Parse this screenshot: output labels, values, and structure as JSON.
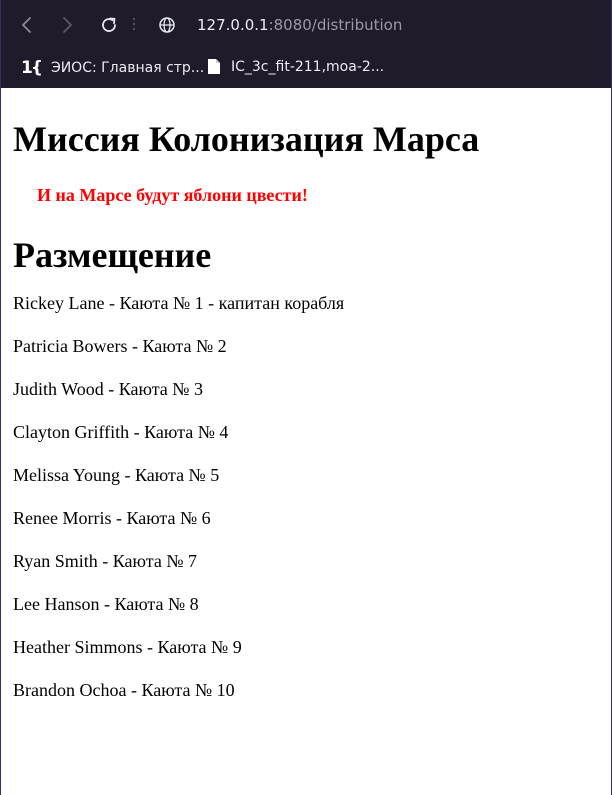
{
  "browser": {
    "url_host": "127.0.0.1",
    "url_rest": ":8080/distribution",
    "bookmarks": [
      {
        "label": "ЭИОС: Главная стр..."
      },
      {
        "label": "IC_3c_fit-211,moa-2..."
      }
    ]
  },
  "page": {
    "title": "Миссия Колонизация Марса",
    "slogan": "И на Марсе будут яблони цвести!",
    "section_title": "Размещение",
    "assignments": [
      "Rickey Lane - Каюта № 1 - капитан корабля",
      "Patricia Bowers - Каюта № 2",
      "Judith Wood - Каюта № 3",
      "Clayton Griffith - Каюта № 4",
      "Melissa Young - Каюта № 5",
      "Renee Morris - Каюта № 6",
      "Ryan Smith - Каюта № 7",
      "Lee Hanson - Каюта № 8",
      "Heather Simmons - Каюта № 9",
      "Brandon Ochoa - Каюта № 10"
    ]
  },
  "colors": {
    "chrome_bg": "#1f1b2b",
    "slogan": "#ff0000"
  }
}
